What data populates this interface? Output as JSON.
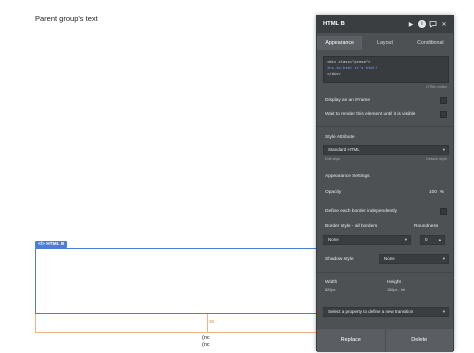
{
  "canvas": {
    "parent_text": "Parent group's text",
    "html_tag": "</> HTML B",
    "margin_label": "35",
    "nc_line1": "(nc",
    "nc_line2": "(nc"
  },
  "panel": {
    "title": "HTML B",
    "icons": [
      "play-icon",
      "info-icon",
      "comment-icon",
      "close-icon"
    ],
    "tabs": [
      "Appearance",
      "Layout",
      "Conditional"
    ],
    "active_tab": "Appearance",
    "code_lines": [
      "<div class=\"prose\">",
      "Ins-to-html it's html!",
      "</div>"
    ],
    "html_editor_caption": "HTML editor",
    "display_iframe_label": "Display as an iFrame",
    "wait_render_label": "Wait to render this element until it is visible",
    "style_attribute_label": "Style Attribute",
    "style_value": "Standard HTML",
    "edit_style": "Edit style",
    "detach_style": "Detach style",
    "appearance_settings_label": "Appearance Settings",
    "opacity_label": "Opacity",
    "opacity_value": "100",
    "opacity_unit": "%",
    "define_border_label": "Define each border independently",
    "border_style_label": "Border style - all borders",
    "roundness_label": "Roundness",
    "border_style_value": "None",
    "roundness_value": "0",
    "shadow_style_label": "Shadow style",
    "shadow_style_value": "None",
    "width_label": "Width",
    "width_value": "820px",
    "height_label": "Height",
    "height_value": "150px - inf",
    "transition_placeholder": "Select a property to define a new transition",
    "replace_button": "Replace",
    "delete_button": "Delete"
  },
  "colors": {
    "panel_bg": "#4d5154",
    "header_bg": "#3b3e41",
    "selection_blue": "#4a7fd6",
    "margin_orange": "#f0b48a"
  }
}
